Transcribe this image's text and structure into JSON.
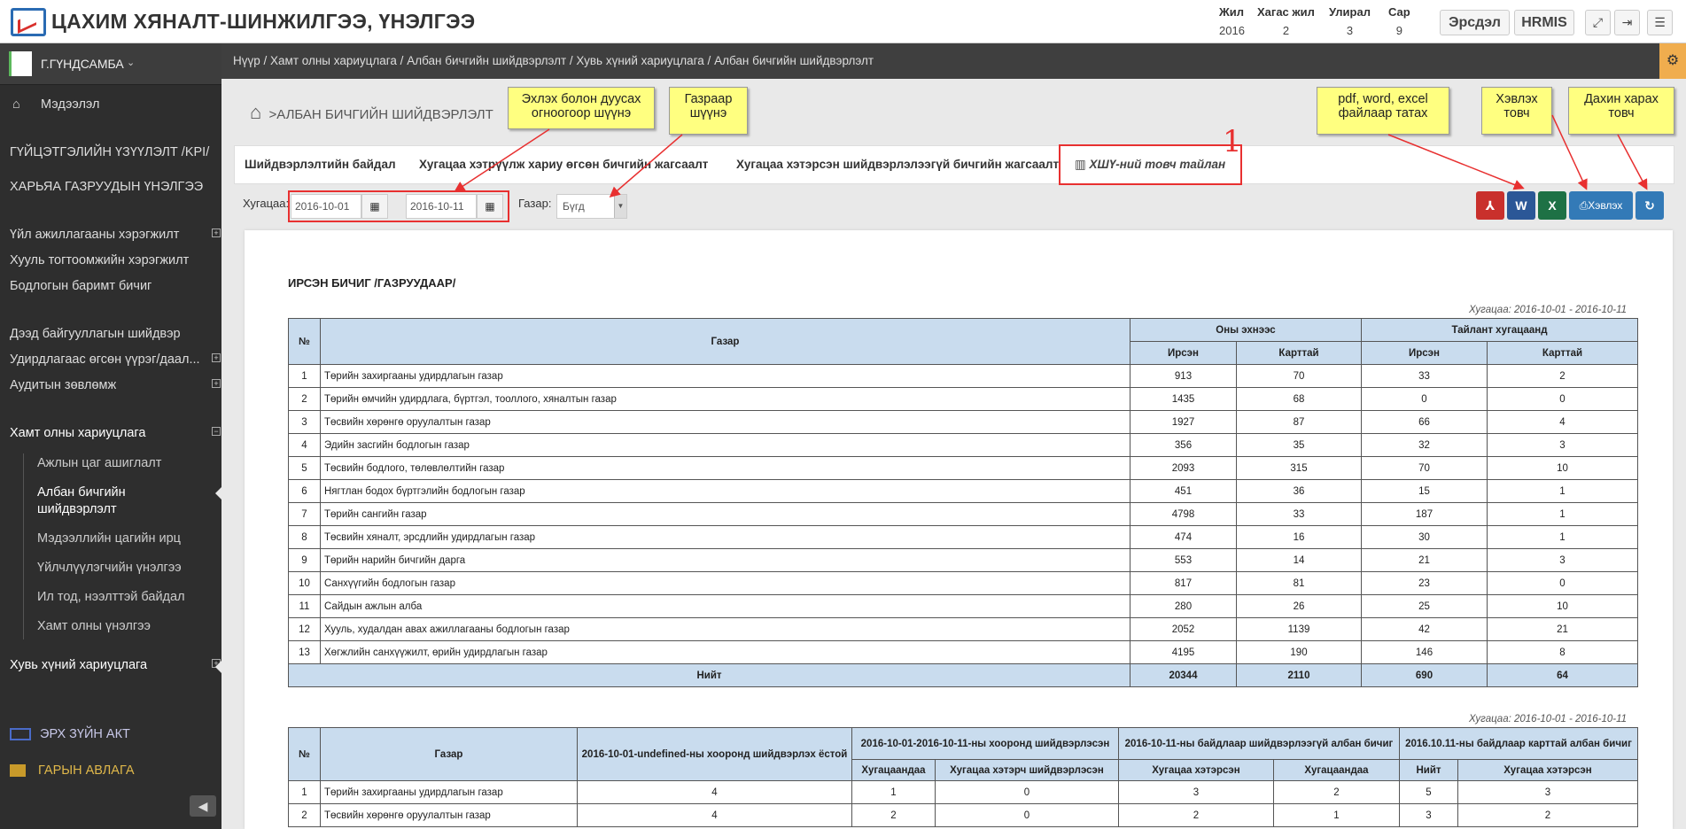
{
  "app": {
    "title": "ЦАХИМ ХЯНАЛТ-ШИНЖИЛГЭЭ, ҮНЭЛГЭЭ",
    "logo_icon": "chart-monitor-icon"
  },
  "period": {
    "year_label": "Жил",
    "year": "2016",
    "half_label": "Хагас жил",
    "half": "2",
    "quarter_label": "Улирал",
    "quarter": "3",
    "month_label": "Сар",
    "month": "9"
  },
  "header_buttons": {
    "ersdel": "Эрсдэл",
    "hrmis": "HRMIS",
    "fullscreen_icon": "expand-icon",
    "logout_icon": "logout-icon",
    "menu_icon": "hamburger-icon"
  },
  "user": {
    "name": "Г.ГҮНДСАМБА"
  },
  "sidebar": {
    "info": "Мэдээлэл",
    "kpi": "ГҮЙЦЭТГЭЛИЙН ҮЗҮҮЛЭЛТ /KPI/",
    "sub_eval": "ХАРЬЯА ГАЗРУУДЫН ҮНЭЛГЭЭ",
    "ops": "Үйл ажиллагааны хэрэгжилт",
    "law": "Хууль тогтоомжийн хэрэгжилт",
    "policy": "Бодлогын баримт бичиг",
    "higher": "Дээд байгууллагын шийдвэр",
    "mgmt": "Удирдлагаас өгсөн үүрэг/даал...",
    "audit": "Аудитын зөвлөмж",
    "team": "Хамт олны хариуцлага",
    "team_items": [
      "Ажлын цаг ашиглалт",
      "Албан бичгийн шийдвэрлэлт",
      "Мэдээллийн цагийн ирц",
      "Үйлчлүүлэгчийн үнэлгээ",
      "Ил тод, нээлттэй байдал",
      "Хамт олны үнэлгээ"
    ],
    "personal": "Хувь хүний хариуцлага",
    "legal": "ЭРХ ЗҮЙН АКТ",
    "receivable": "ГАРЫН АВЛАГА"
  },
  "breadcrumb": [
    "Нүүр",
    "Хамт олны хариуцлага",
    "Албан бичгийн шийдвэрлэлт",
    "Хувь хүний хариуцлага",
    "Албан бичгийн шийдвэрлэлт"
  ],
  "page": {
    "title": ">АЛБАН БИЧГИЙН ШИЙДВЭРЛЭЛТ"
  },
  "tabs": [
    "Шийдвэрлэлтийн байдал",
    "Хугацаа хэтрүүлж хариу өгсөн бичгийн жагсаалт",
    "Хугацаа хэтэрсэн шийдвэрлэлээгүй бичгийн жагсаалт",
    "ХШҮ-ний товч тайлан"
  ],
  "filters": {
    "period_label": "Хугацаа:",
    "date_from": "2016-10-01",
    "date_to": "2016-10-11",
    "place_label": "Газар:",
    "place_value": "Бүгд"
  },
  "export": {
    "print_label": "Хэвлэх"
  },
  "callouts": {
    "date": "Эхлэх болон дуусах огноогоор шүүнэ",
    "place": "Газраар шүүнэ",
    "files": "pdf, word, excel файлаар татах",
    "print": "Хэвлэх товч",
    "refresh": "Дахин харах товч",
    "number": "1"
  },
  "report": {
    "title": "ИРСЭН БИЧИГ /ГАЗРУУДААР/",
    "period": "Хугацаа: 2016-10-01 - 2016-10-11",
    "headers": {
      "no": "№",
      "place": "Газар",
      "year_start": "Оны эхнээс",
      "period": "Тайлант хугацаанд",
      "received": "Ирсэн",
      "card": "Карттай"
    },
    "rows": [
      [
        "1",
        "Төрийн захиргааны удирдлагын газар",
        "913",
        "70",
        "33",
        "2"
      ],
      [
        "2",
        "Төрийн өмчийн удирдлага, бүртгэл, тооллого, хяналтын газар",
        "1435",
        "68",
        "0",
        "0"
      ],
      [
        "3",
        "Төсвийн хөрөнгө оруулалтын газар",
        "1927",
        "87",
        "66",
        "4"
      ],
      [
        "4",
        "Эдийн засгийн бодлогын газар",
        "356",
        "35",
        "32",
        "3"
      ],
      [
        "5",
        "Төсвийн бодлого, төлөвлөлтийн газар",
        "2093",
        "315",
        "70",
        "10"
      ],
      [
        "6",
        "Нягтлан бодох бүртгэлийн бодлогын газар",
        "451",
        "36",
        "15",
        "1"
      ],
      [
        "7",
        "Төрийн сангийн газар",
        "4798",
        "33",
        "187",
        "1"
      ],
      [
        "8",
        "Төсвийн хяналт, эрсдлийн удирдлагын газар",
        "474",
        "16",
        "30",
        "1"
      ],
      [
        "9",
        "Төрийн нарийн бичгийн дарга",
        "553",
        "14",
        "21",
        "3"
      ],
      [
        "10",
        "Санхүүгийн бодлогын газар",
        "817",
        "81",
        "23",
        "0"
      ],
      [
        "11",
        "Сайдын ажлын алба",
        "280",
        "26",
        "25",
        "10"
      ],
      [
        "12",
        "Хууль, худалдан авах ажиллагааны бодлогын газар",
        "2052",
        "1139",
        "42",
        "21"
      ],
      [
        "13",
        "Хөгжлийн санхүүжилт, өрийн удирдлагын газар",
        "4195",
        "190",
        "146",
        "8"
      ]
    ],
    "total": [
      "Нийт",
      "20344",
      "2110",
      "690",
      "64"
    ]
  },
  "report2": {
    "period": "Хугацаа: 2016-10-01 - 2016-10-11",
    "headers": {
      "no": "№",
      "place": "Газар",
      "pending": "2016-10-01-undefined-ны хооронд шийдвэрлэх ёстой",
      "resolved": "2016-10-01-2016-10-11-ны хооронд шийдвэрлэсэн",
      "unresolved": "2016-10-11-ны байдлаар шийдвэрлээгүй албан бичиг",
      "card": "2016.10.11-ны байдлаар карттай албан бичиг",
      "on_time": "Хугацаандаа",
      "late_resolved": "Хугацаа хэтэрч шийдвэрлэсэн",
      "overdue": "Хугацаа хэтэрсэн",
      "in_time": "Хугацаандаа",
      "total": "Нийт",
      "card_overdue": "Хугацаа хэтэрсэн"
    },
    "rows": [
      [
        "1",
        "Төрийн захиргааны удирдлагын газар",
        "4",
        "1",
        "0",
        "3",
        "2",
        "5",
        "3"
      ],
      [
        "2",
        "Төсвийн хөрөнгө оруулалтын газар",
        "4",
        "2",
        "0",
        "2",
        "1",
        "3",
        "2"
      ]
    ]
  }
}
